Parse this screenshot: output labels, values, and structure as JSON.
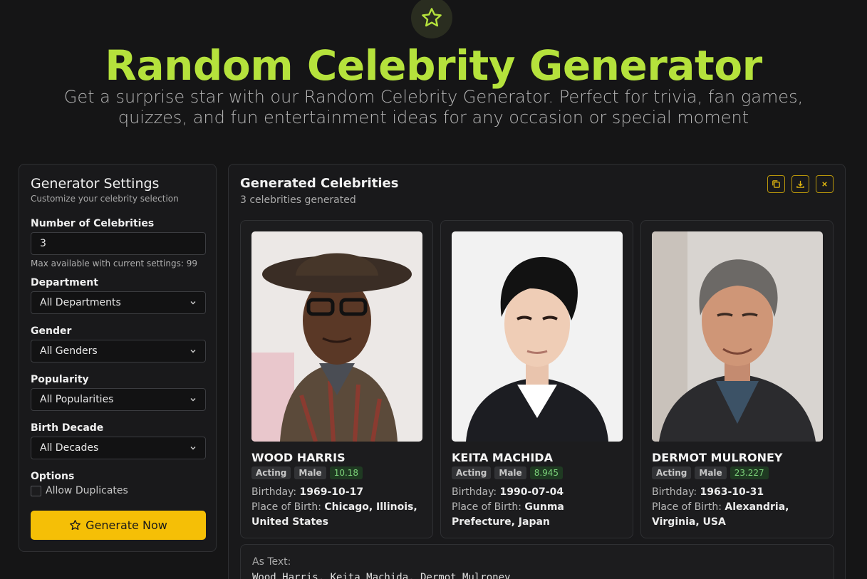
{
  "header": {
    "title": "Random Celebrity Generator",
    "subtitle": "Get a surprise star with our Random Celebrity Generator. Perfect for trivia, fan games, quizzes, and fun entertainment ideas for any occasion or special moment",
    "icon": "star-icon"
  },
  "settings": {
    "title": "Generator Settings",
    "subtitle": "Customize your celebrity selection",
    "count_label": "Number of Celebrities",
    "count_value": "3",
    "count_hint": "Max available with current settings: 99",
    "department_label": "Department",
    "department_value": "All Departments",
    "gender_label": "Gender",
    "gender_value": "All Genders",
    "popularity_label": "Popularity",
    "popularity_value": "All Popularities",
    "decade_label": "Birth Decade",
    "decade_value": "All Decades",
    "options_label": "Options",
    "duplicates_label": "Allow Duplicates",
    "generate_label": "Generate Now"
  },
  "results": {
    "title": "Generated Celebrities",
    "subtitle": "3 celebrities generated",
    "birthday_label": "Birthday:",
    "birthplace_label": "Place of Birth:",
    "astext_label": "As Text:",
    "astext_value": "Wood Harris, Keita Machida, Dermot Mulroney",
    "cards": [
      {
        "name": "WOOD HARRIS",
        "department": "Acting",
        "gender": "Male",
        "score": "10.18",
        "birthday": "1969-10-17",
        "birthplace": "Chicago, Illinois, United States"
      },
      {
        "name": "KEITA MACHIDA",
        "department": "Acting",
        "gender": "Male",
        "score": "8.945",
        "birthday": "1990-07-04",
        "birthplace": "Gunma Prefecture, Japan"
      },
      {
        "name": "DERMOT MULRONEY",
        "department": "Acting",
        "gender": "Male",
        "score": "23.227",
        "birthday": "1963-10-31",
        "birthplace": "Alexandria, Virginia, USA"
      }
    ]
  },
  "colors": {
    "accent": "#b5e23c",
    "button": "#f5bf06",
    "background": "#151516"
  }
}
